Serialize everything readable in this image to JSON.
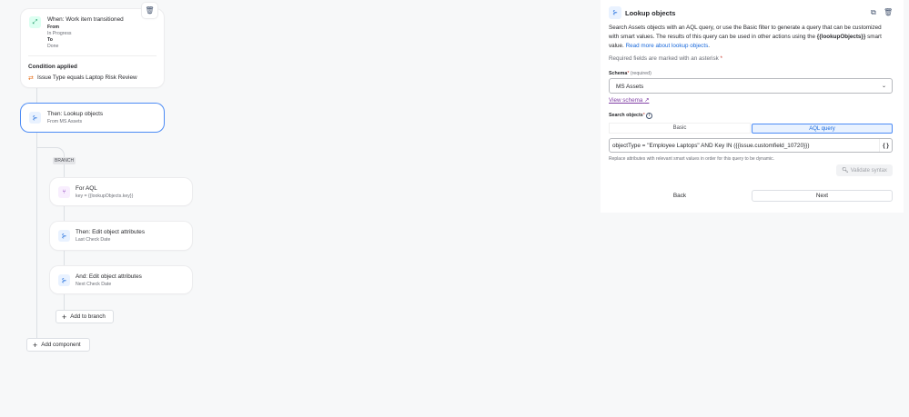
{
  "trigger": {
    "title": "When: Work item transitioned",
    "from_label": "From",
    "from_value": "In Progress",
    "to_label": "To",
    "to_value": "Done",
    "condition_heading": "Condition applied",
    "condition_text": "Issue Type equals Laptop Risk Review"
  },
  "lookup_card": {
    "title": "Then: Lookup objects",
    "subtitle": "From MS Assets"
  },
  "branch": {
    "label": "BRANCH",
    "items": [
      {
        "title": "For AQL",
        "subtitle": "key = {{lookupObjects.key}}"
      },
      {
        "title": "Then: Edit object attributes",
        "subtitle": "Last Check Date"
      },
      {
        "title": "And: Edit object attributes",
        "subtitle": "Next Check Date"
      }
    ],
    "add_label": "Add to branch"
  },
  "add_component_label": "Add component",
  "panel": {
    "title": "Lookup objects",
    "desc_1": "Search Assets objects with an AQL query, or use the Basic filter to generate a query that can be customized",
    "desc_2a": "with smart values. The results of this query can be used in other actions using the ",
    "desc_2b": "{{lookupObjects}}",
    "desc_2c": " smart",
    "desc_3a": "value. ",
    "desc_link": "Read more about lookup objects",
    "desc_3b": ".",
    "required_note": "Required fields are marked with an asterisk",
    "schema_label": "Schema",
    "schema_required": "(required)",
    "schema_value": "MS Assets",
    "view_schema": "View schema",
    "search_label": "Search objects",
    "tabs": [
      "Basic",
      "AQL query"
    ],
    "query_value": "objectType = \"Employee Laptops\" AND Key IN ({{issue.customfield_10720}})",
    "smart_btn": "{ }",
    "helper": "Replace attributes with relevant smart values in order for this query to be dynamic.",
    "validate": "Validate syntax",
    "back": "Back",
    "next": "Next"
  },
  "colors": {
    "accent": "#1868db",
    "required": "#c9372c",
    "trigger_green": "#22a06b"
  }
}
